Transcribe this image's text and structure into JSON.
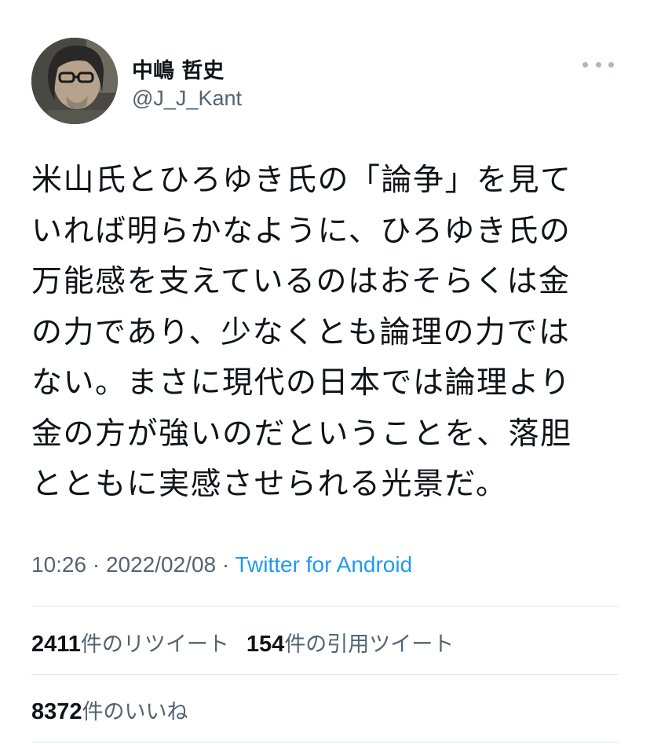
{
  "user": {
    "display_name": "中嶋 哲史",
    "handle": "@J_J_Kant"
  },
  "more_icon": "ellipsis-icon",
  "tweet": {
    "lines": [
      "米山氏とひろゆき氏の「論争」を見て",
      "いれば明らかなように、ひろゆき氏の",
      "万能感を支えているのはおそらくは金",
      "の力であり、少なくとも論理の力では",
      "ない。まさに現代の日本では論理より",
      "金の方が強いのだということを、落胆",
      "とともに実感させられる光景だ。"
    ]
  },
  "meta": {
    "time": "10:26",
    "separator": " · ",
    "date": "2022/02/08",
    "source": "Twitter for Android"
  },
  "stats": {
    "retweets_count": "2411",
    "retweets_label": "件のリツイート",
    "quotes_count": "154",
    "quotes_label": "件の引用ツイート",
    "likes_count": "8372",
    "likes_label": "件のいいね"
  },
  "colors": {
    "text": "#0f1419",
    "secondary": "#536471",
    "link": "#1d9bf0",
    "divider": "#e1e6ea"
  }
}
